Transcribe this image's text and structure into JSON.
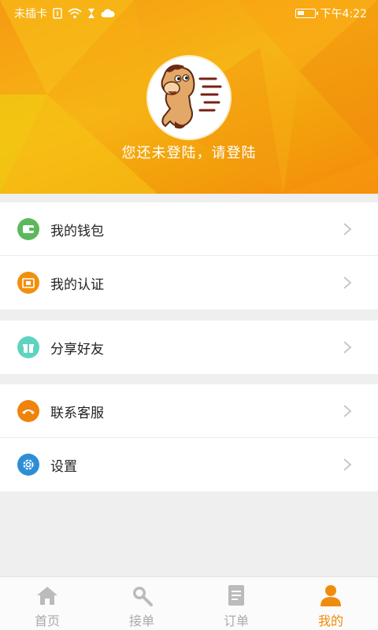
{
  "status_bar": {
    "carrier": "未插卡",
    "time": "下午4:22"
  },
  "profile": {
    "login_prompt": "您还未登陆，请登陆"
  },
  "menu": [
    {
      "label": "我的钱包",
      "icon": "wallet-icon",
      "color": "#5cb85c"
    },
    {
      "label": "我的认证",
      "icon": "certificate-icon",
      "color": "#f0900e"
    },
    {
      "label": "分享好友",
      "icon": "gift-icon",
      "color": "#5ed3c0"
    },
    {
      "label": "联系客服",
      "icon": "phone-icon",
      "color": "#f0830c"
    },
    {
      "label": "设置",
      "icon": "gear-icon",
      "color": "#2c8fd6"
    }
  ],
  "tabs": [
    {
      "label": "首页",
      "icon": "home-icon",
      "active": false
    },
    {
      "label": "接单",
      "icon": "search-icon",
      "active": false
    },
    {
      "label": "订单",
      "icon": "document-icon",
      "active": false
    },
    {
      "label": "我的",
      "icon": "person-icon",
      "active": true
    }
  ],
  "colors": {
    "accent": "#f08c0c",
    "inactive": "#aaaaaa"
  }
}
